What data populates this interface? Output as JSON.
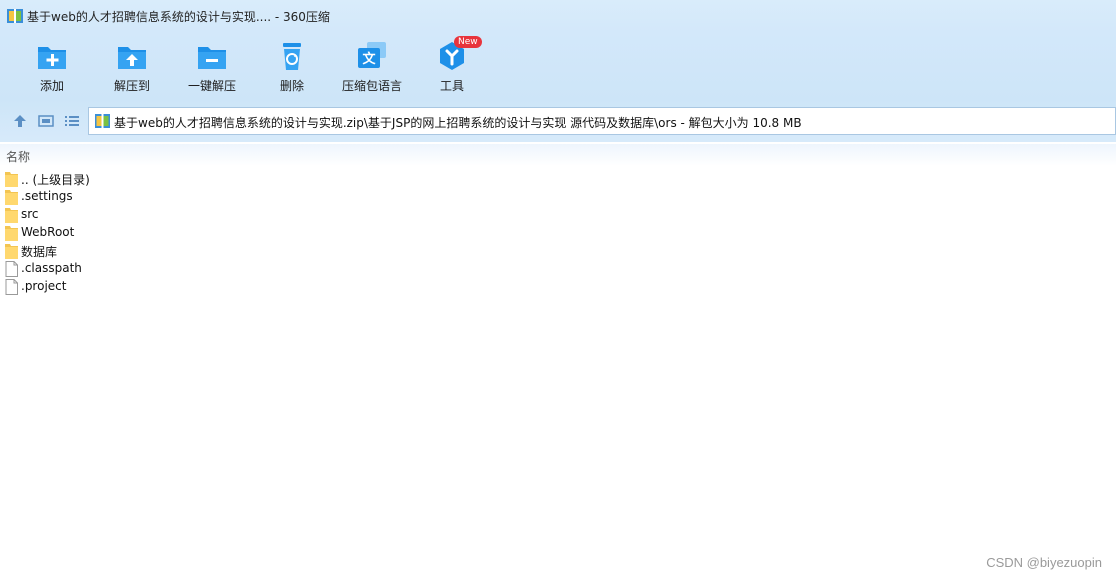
{
  "window": {
    "title": "基于web的人才招聘信息系统的设计与实现.... - 360压缩"
  },
  "toolbar": {
    "items": [
      {
        "label": "添加",
        "icon": "add-folder-icon"
      },
      {
        "label": "解压到",
        "icon": "extract-to-icon"
      },
      {
        "label": "一键解压",
        "icon": "one-click-extract-icon"
      },
      {
        "label": "删除",
        "icon": "trash-icon"
      },
      {
        "label": "压缩包语言",
        "icon": "language-icon"
      },
      {
        "label": "工具",
        "icon": "tools-icon",
        "badge": "New"
      }
    ]
  },
  "address": {
    "path": "基于web的人才招聘信息系统的设计与实现.zip\\基于JSP的网上招聘系统的设计与实现 源代码及数据库\\ors - 解包大小为 10.8 MB"
  },
  "list": {
    "column_name": "名称",
    "items": [
      {
        "name": ".. (上级目录)",
        "type": "folder"
      },
      {
        "name": ".settings",
        "type": "folder"
      },
      {
        "name": "src",
        "type": "folder"
      },
      {
        "name": "WebRoot",
        "type": "folder"
      },
      {
        "name": "数据库",
        "type": "folder"
      },
      {
        "name": ".classpath",
        "type": "file"
      },
      {
        "name": ".project",
        "type": "file"
      }
    ]
  },
  "watermark": "CSDN @biyezuopin",
  "colors": {
    "accent": "#1e90e8",
    "toolbar_bg": "#d3e8fa",
    "folder": "#ffd86e",
    "badge": "#e8343c"
  }
}
